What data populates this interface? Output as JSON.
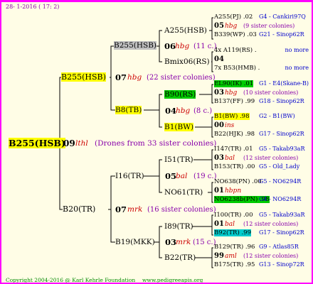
{
  "header": {
    "date_text": "28- 1-2016 ( 17: 2)"
  },
  "footer": {
    "copyright": "Copyright 2004-2016 @ Karl Kehrle Foundation",
    "url": "www.pedigreeapis.org"
  },
  "root": {
    "name": "B255(HSB)",
    "year": "09",
    "yr_code": "lthl",
    "note": "(Drones from 33 sister colonies)"
  },
  "g1": [
    {
      "name": "B255(HSB)",
      "year": "07",
      "code": "hbg",
      "note": "(22 sister colonies)"
    },
    {
      "name": "B20(TR)",
      "year": "07",
      "code": "mrk",
      "note": "(16 sister colonies)"
    }
  ],
  "g2": [
    {
      "name": "B255(HSB)",
      "year": "06",
      "code": "hbg",
      "note": "(11 c.)"
    },
    {
      "name": "B8(TB)",
      "year": "04",
      "code": "hbg",
      "note": "(8 c.)"
    },
    {
      "name": "I16(TR)",
      "year": "05",
      "code": "bal",
      "note": "(19 c.)"
    },
    {
      "name": "B19(MKK)",
      "year": "03",
      "code": "mrk",
      "note": "(15 c.)"
    }
  ],
  "g3": [
    {
      "name": "A255(HSB)"
    },
    {
      "name": "Bmix06(RS)"
    },
    {
      "name": "B90(RS)"
    },
    {
      "name": "B1(BW)"
    },
    {
      "name": "I51(TR)"
    },
    {
      "name": "NO61(TR)"
    },
    {
      "name": "I89(TR)"
    },
    {
      "name": "B22(TR)"
    }
  ],
  "g4": [
    {
      "l1": "A255(PJ) .02",
      "r1": "G4 - Cankiri97Q",
      "l2": "05",
      "code": "hbg",
      "note": "(9 sister colonies)",
      "l3": "B339(WP) .03",
      "r3": "G21 - Sinop62R"
    },
    {
      "l1": "4x A119(RS) .",
      "r1": "no more",
      "l2": "04",
      "code": "",
      "note": "",
      "l3": "7x B53(HMB) .",
      "r3": "no more"
    },
    {
      "l1": "EL90(IK) .01",
      "r1": "G1 - E4(Skane-B)",
      "l2": "03",
      "code": "hbg",
      "note": "(10 sister colonies)",
      "l3": "B137(FF) .99",
      "r3": "G18 - Sinop62R"
    },
    {
      "l1": "B1(BW) .98",
      "r1": "G2 - B1(BW)",
      "l2": "00",
      "code": "ins",
      "note": "",
      "l3": "B22(HJK) .98",
      "r3": "G17 - Sinop62R"
    },
    {
      "l1": "I147(TR) .01",
      "r1": "G5 - Takab93aR",
      "l2": "03",
      "code": "bal",
      "note": "(12 sister colonies)",
      "l3": "B153(TR) .00",
      "r3": "G5 - Old_Lady"
    },
    {
      "l1": "NO638(PN) .00",
      "r1": "G5 - NO6294R",
      "l2": "01",
      "code": "hbpn",
      "note": "",
      "l3": "NO6238b(PN) .98",
      "r3": "G4 - NO6294R"
    },
    {
      "l1": "I100(TR) .00",
      "r1": "G5 - Takab93aR",
      "l2": "01",
      "code": "bal",
      "note": "(12 sister colonies)",
      "l3": "B92(TR) .99",
      "r3": "G17 - Sinop62R"
    },
    {
      "l1": "B129(TR) .96",
      "r1": "G9 - Atlas85R",
      "l2": "99",
      "code": "aml",
      "note": "(12 sister colonies)",
      "l3": "B175(TR) .95",
      "r3": "G13 - Sinop72R"
    }
  ]
}
